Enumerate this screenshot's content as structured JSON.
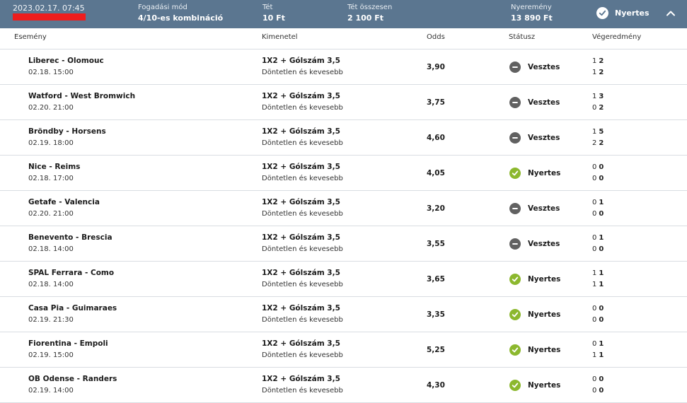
{
  "colors": {
    "header_bg": "#5b7690",
    "win_green": "#8cb82e",
    "loss_gray": "#616161",
    "redaction_red": "#ee1d1d"
  },
  "header": {
    "date": "2023.02.17. 07:45",
    "bet_type_label": "Fogadási mód",
    "bet_type_value": "4/10-es kombináció",
    "stake_label": "Tét",
    "stake_value": "10 Ft",
    "total_stake_label": "Tét összesen",
    "total_stake_value": "2 100 Ft",
    "winnings_label": "Nyeremény",
    "winnings_value": "13 890 Ft",
    "status_icon": "check-circle-icon",
    "status_label": "Nyertes",
    "toggle_icon": "chevron-up-icon"
  },
  "columns": {
    "event": "Esemény",
    "outcome": "Kimenetel",
    "odds": "Odds",
    "status": "Státusz",
    "result": "Végeredmény"
  },
  "rows": [
    {
      "event": "Liberec - Olomouc",
      "date": "02.18. 15:00",
      "bet": "1X2 + Gólszám 3,5",
      "selection": "Döntetlen és kevesebb",
      "odds": "3,90",
      "status": "Vesztes",
      "status_icon": "minus-circle-icon",
      "win": false,
      "score1_a": "1",
      "score1_b": "2",
      "score2_a": "1",
      "score2_b": "2"
    },
    {
      "event": "Watford - West Bromwich",
      "date": "02.20. 21:00",
      "bet": "1X2 + Gólszám 3,5",
      "selection": "Döntetlen és kevesebb",
      "odds": "3,75",
      "status": "Vesztes",
      "status_icon": "minus-circle-icon",
      "win": false,
      "score1_a": "1",
      "score1_b": "3",
      "score2_a": "0",
      "score2_b": "2"
    },
    {
      "event": "Bröndby - Horsens",
      "date": "02.19. 18:00",
      "bet": "1X2 + Gólszám 3,5",
      "selection": "Döntetlen és kevesebb",
      "odds": "4,60",
      "status": "Vesztes",
      "status_icon": "minus-circle-icon",
      "win": false,
      "score1_a": "1",
      "score1_b": "5",
      "score2_a": "2",
      "score2_b": "2"
    },
    {
      "event": "Nice - Reims",
      "date": "02.18. 17:00",
      "bet": "1X2 + Gólszám 3,5",
      "selection": "Döntetlen és kevesebb",
      "odds": "4,05",
      "status": "Nyertes",
      "status_icon": "check-circle-icon",
      "win": true,
      "score1_a": "0",
      "score1_b": "0",
      "score2_a": "0",
      "score2_b": "0"
    },
    {
      "event": "Getafe - Valencia",
      "date": "02.20. 21:00",
      "bet": "1X2 + Gólszám 3,5",
      "selection": "Döntetlen és kevesebb",
      "odds": "3,20",
      "status": "Vesztes",
      "status_icon": "minus-circle-icon",
      "win": false,
      "score1_a": "0",
      "score1_b": "1",
      "score2_a": "0",
      "score2_b": "0"
    },
    {
      "event": "Benevento - Brescia",
      "date": "02.18. 14:00",
      "bet": "1X2 + Gólszám 3,5",
      "selection": "Döntetlen és kevesebb",
      "odds": "3,55",
      "status": "Vesztes",
      "status_icon": "minus-circle-icon",
      "win": false,
      "score1_a": "0",
      "score1_b": "1",
      "score2_a": "0",
      "score2_b": "0"
    },
    {
      "event": "SPAL Ferrara - Como",
      "date": "02.18. 14:00",
      "bet": "1X2 + Gólszám 3,5",
      "selection": "Döntetlen és kevesebb",
      "odds": "3,65",
      "status": "Nyertes",
      "status_icon": "check-circle-icon",
      "win": true,
      "score1_a": "1",
      "score1_b": "1",
      "score2_a": "1",
      "score2_b": "1"
    },
    {
      "event": "Casa Pia - Guimaraes",
      "date": "02.19. 21:30",
      "bet": "1X2 + Gólszám 3,5",
      "selection": "Döntetlen és kevesebb",
      "odds": "3,35",
      "status": "Nyertes",
      "status_icon": "check-circle-icon",
      "win": true,
      "score1_a": "0",
      "score1_b": "0",
      "score2_a": "0",
      "score2_b": "0"
    },
    {
      "event": "Fiorentina - Empoli",
      "date": "02.19. 15:00",
      "bet": "1X2 + Gólszám 3,5",
      "selection": "Döntetlen és kevesebb",
      "odds": "5,25",
      "status": "Nyertes",
      "status_icon": "check-circle-icon",
      "win": true,
      "score1_a": "0",
      "score1_b": "1",
      "score2_a": "1",
      "score2_b": "1"
    },
    {
      "event": "OB Odense - Randers",
      "date": "02.19. 14:00",
      "bet": "1X2 + Gólszám 3,5",
      "selection": "Döntetlen és kevesebb",
      "odds": "4,30",
      "status": "Nyertes",
      "status_icon": "check-circle-icon",
      "win": true,
      "score1_a": "0",
      "score1_b": "0",
      "score2_a": "0",
      "score2_b": "0"
    }
  ]
}
